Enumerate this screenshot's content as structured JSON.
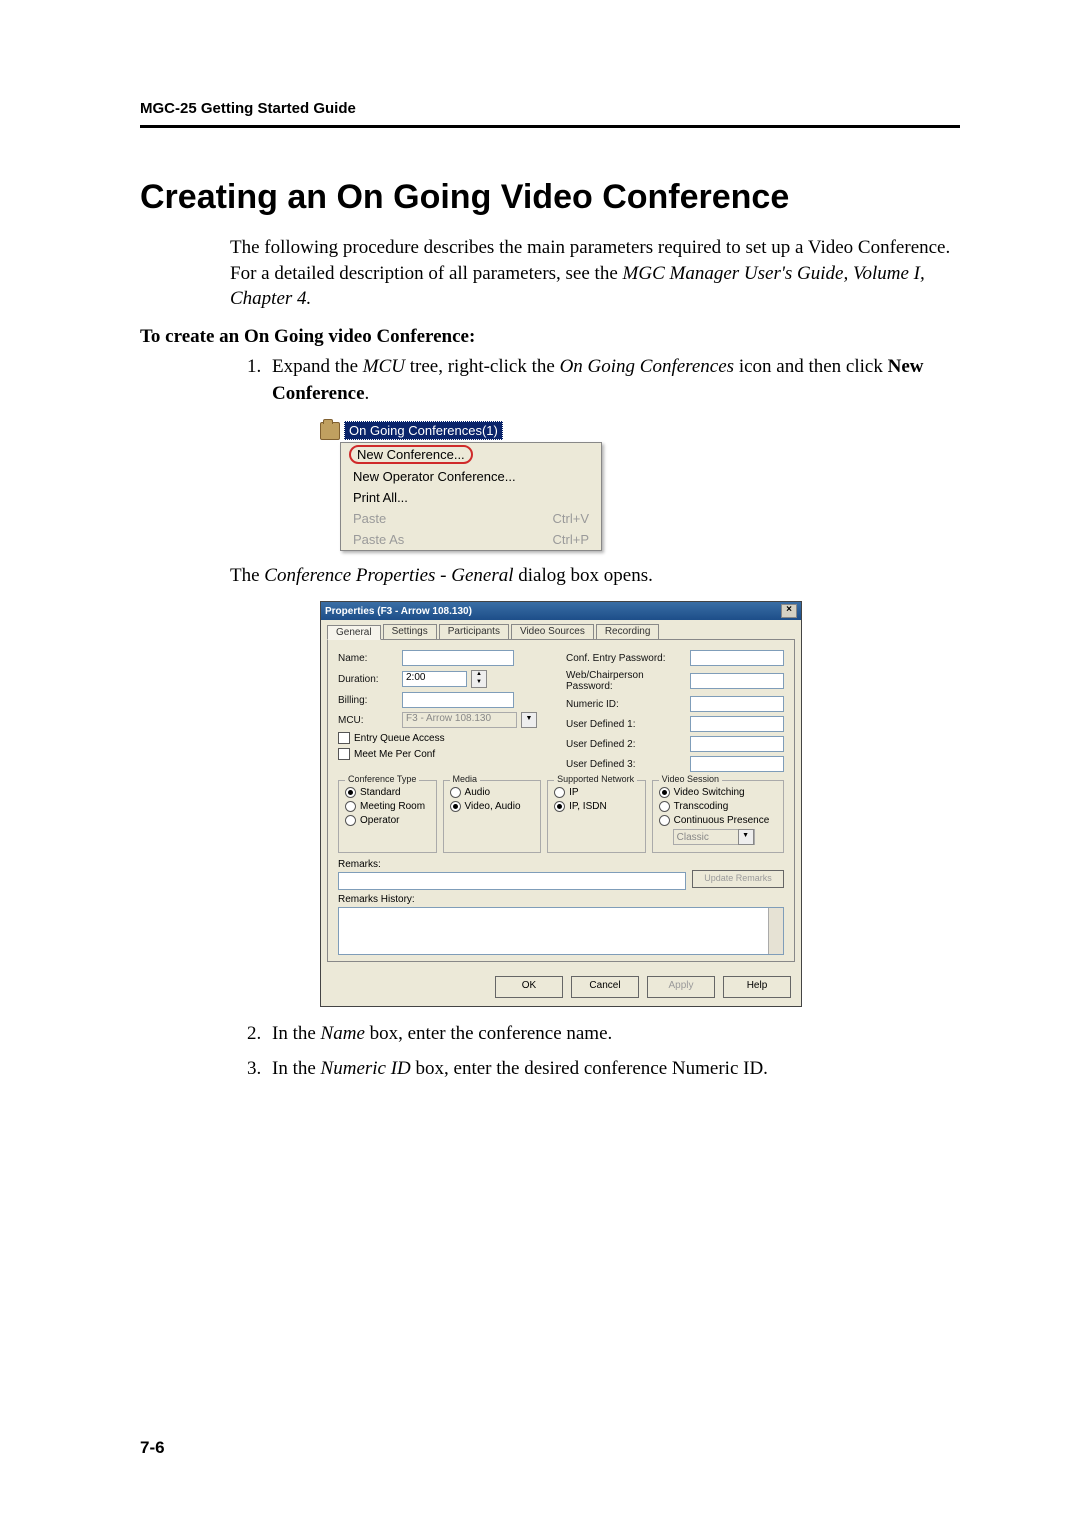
{
  "running_head": "MGC-25 Getting Started Guide",
  "h1": "Creating an On Going Video Conference",
  "intro_plain": "The following procedure describes the main parameters required to set up a Video Conference. For a detailed description of all parameters, see the ",
  "intro_italic": "MGC Manager User's Guide, Volume I, Chapter 4.",
  "procedure_head": "To create an On Going video Conference:",
  "step1_a": "Expand the ",
  "step1_i1": "MCU",
  "step1_b": " tree, right-click the ",
  "step1_i2": "On Going Conferences",
  "step1_c": " icon and then click ",
  "step1_bold": "New Conference",
  "step1_d": ".",
  "ctx": {
    "tree_label": "On Going Conferences(1)",
    "items": {
      "new_conf": "New Conference...",
      "new_op_conf": "New Operator Conference...",
      "print_all": "Print All...",
      "paste": "Paste",
      "paste_sc": "Ctrl+V",
      "paste_as": "Paste As",
      "paste_as_sc": "Ctrl+P"
    }
  },
  "caption_a": "The ",
  "caption_i": "Conference Properties - General",
  "caption_b": " dialog box opens.",
  "dlg": {
    "title": "Properties (F3 - Arrow 108.130)",
    "tabs": [
      "General",
      "Settings",
      "Participants",
      "Video Sources",
      "Recording"
    ],
    "labels": {
      "name": "Name:",
      "duration": "Duration:",
      "duration_val": "2:00",
      "billing": "Billing:",
      "mcu": "MCU:",
      "mcu_val": "F3 - Arrow 108.130",
      "entry_queue": "Entry Queue Access",
      "meet_me": "Meet Me Per Conf",
      "conf_pwd": "Conf. Entry Password:",
      "chair_pwd": "Web/Chairperson Password:",
      "numeric_id": "Numeric ID:",
      "ud1": "User Defined 1:",
      "ud2": "User Defined 2:",
      "ud3": "User Defined 3:"
    },
    "grp_conf_type": {
      "title": "Conference Type",
      "standard": "Standard",
      "meeting": "Meeting Room",
      "operator": "Operator"
    },
    "grp_media": {
      "title": "Media",
      "audio": "Audio",
      "va": "Video, Audio"
    },
    "grp_net": {
      "title": "Supported Network",
      "ip": "IP",
      "ipisdn": "IP, ISDN"
    },
    "grp_video": {
      "title": "Video Session",
      "vs": "Video Switching",
      "tc": "Transcoding",
      "cp": "Continuous Presence",
      "layout": "Classic"
    },
    "remarks": "Remarks:",
    "remarks_history": "Remarks History:",
    "update_remarks": "Update Remarks",
    "buttons": {
      "ok": "OK",
      "cancel": "Cancel",
      "apply": "Apply",
      "help": "Help"
    }
  },
  "step2_a": "In the ",
  "step2_i": "Name",
  "step2_b": " box, enter the conference name.",
  "step3_a": "In the ",
  "step3_i": "Numeric ID",
  "step3_b": " box, enter the desired conference Numeric ID.",
  "page_num": "7-6"
}
